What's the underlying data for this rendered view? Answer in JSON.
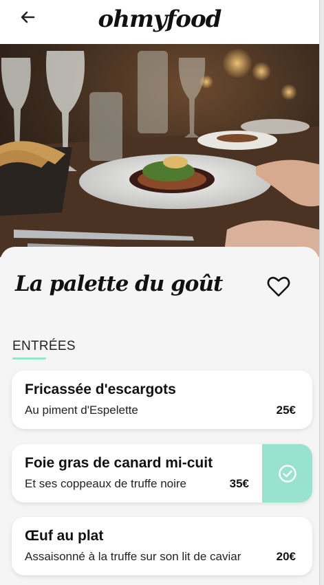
{
  "app": {
    "logo": "ohmyfood"
  },
  "header": {
    "back_icon": "arrow-left-icon"
  },
  "restaurant": {
    "name": "La palette du goût",
    "favorite_icon": "heart-outline-icon"
  },
  "menu": {
    "section_title": "ENTRÉES",
    "items": [
      {
        "name": "Fricassée d'escargots",
        "description": "Au piment d'Espelette",
        "price": "25€",
        "selected": false
      },
      {
        "name": "Foie gras de canard mi-cuit",
        "description": "Et ses coppeaux de truffe noire",
        "price": "35€",
        "selected": true,
        "check_icon": "check-circle-icon"
      },
      {
        "name": "Œuf au plat",
        "description": "Assaisonné à la truffe sur son lit de caviar",
        "price": "20€",
        "selected": false
      }
    ]
  },
  "colors": {
    "accent": "#99e2d0",
    "sheet_bg": "#f5f5f5",
    "card_bg": "#ffffff",
    "text": "#111111"
  }
}
